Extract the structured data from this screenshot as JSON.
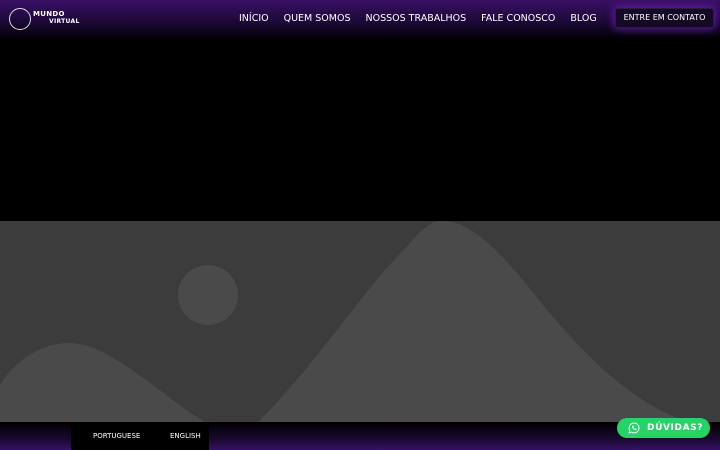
{
  "header": {
    "logo": {
      "line1": "MUNDO",
      "line2": "VIRTUAL"
    },
    "nav": [
      {
        "label": "INÍCIO"
      },
      {
        "label": "QUEM SOMOS"
      },
      {
        "label": "NOSSOS TRABALHOS"
      },
      {
        "label": "FALE CONOSCO"
      },
      {
        "label": "BLOG"
      }
    ],
    "cta_label": "ENTRE EM CONTATO"
  },
  "footer": {
    "languages": [
      {
        "label": "PORTUGUESE"
      },
      {
        "label": "ENGLISH"
      }
    ]
  },
  "whatsapp": {
    "label": "DÚVIDAS?",
    "icon": "whatsapp-icon"
  },
  "colors": {
    "header_purple": "#3a0f66",
    "cta_glow": "#8428dc",
    "placeholder_bg": "#3c3c3c",
    "placeholder_shape": "#4a4a4a",
    "whatsapp_green": "#25d366"
  }
}
